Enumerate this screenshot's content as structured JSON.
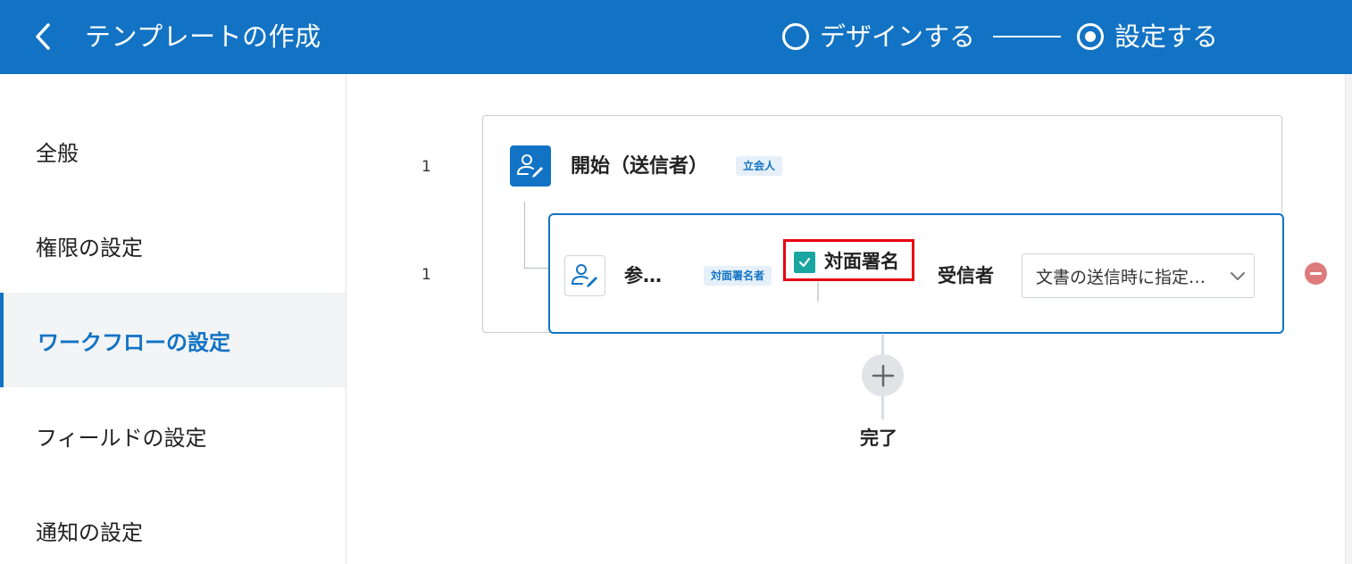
{
  "header": {
    "title": "テンプレートの作成",
    "steps": [
      {
        "label": "デザインする",
        "selected": false
      },
      {
        "label": "設定する",
        "selected": true
      }
    ],
    "bg_color": "#1273c4"
  },
  "sidebar": {
    "items": [
      {
        "label": "全般",
        "active": false
      },
      {
        "label": "権限の設定",
        "active": false
      },
      {
        "label": "ワークフローの設定",
        "active": true
      },
      {
        "label": "フィールドの設定",
        "active": false
      },
      {
        "label": "通知の設定",
        "active": false
      }
    ]
  },
  "workflow": {
    "start_step": {
      "order": "1",
      "title": "開始（送信者）",
      "tag": "立会人",
      "icon": "person-edit-icon"
    },
    "participant": {
      "order": "1",
      "name": "参…",
      "tag": "対面署名者",
      "icon": "person-edit-icon",
      "in_person_signing": {
        "label": "対面署名",
        "checked": true
      },
      "recipient_label": "受信者",
      "recipient_select": {
        "value": "文書の送信時に指定…"
      }
    },
    "end_label": "完了"
  },
  "colors": {
    "accent": "#1273c4",
    "checkbox": "#1aa6a0",
    "highlight": "#e60012",
    "remove": "#dd7b7c"
  }
}
